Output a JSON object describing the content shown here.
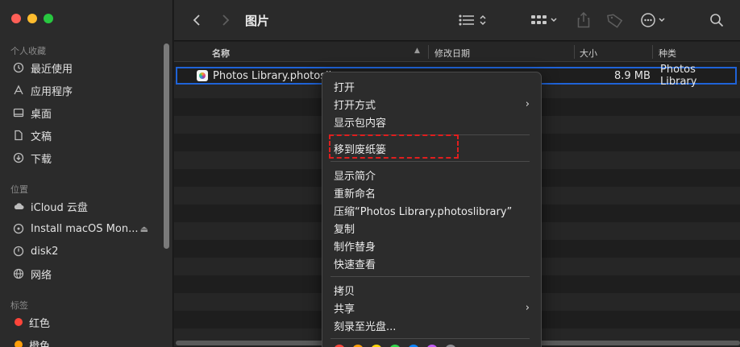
{
  "sidebar": {
    "favorites_title": "个人收藏",
    "favorites": [
      {
        "label": "最近使用",
        "icon": "clock-icon"
      },
      {
        "label": "应用程序",
        "icon": "apps-icon"
      },
      {
        "label": "桌面",
        "icon": "desktop-icon"
      },
      {
        "label": "文稿",
        "icon": "document-icon"
      },
      {
        "label": "下载",
        "icon": "download-icon"
      }
    ],
    "locations_title": "位置",
    "locations": [
      {
        "label": "iCloud 云盘",
        "icon": "cloud-icon"
      },
      {
        "label": "Install macOS Mon...",
        "icon": "disk-icon",
        "eject": true
      },
      {
        "label": "disk2",
        "icon": "disk-icon"
      },
      {
        "label": "网络",
        "icon": "globe-icon"
      }
    ],
    "tags_title": "标签",
    "tags": [
      {
        "label": "红色",
        "color": "#ff453a"
      },
      {
        "label": "橙色",
        "color": "#ff9f0a"
      }
    ]
  },
  "toolbar": {
    "title": "图片"
  },
  "columns": {
    "name": "名称",
    "modified": "修改日期",
    "size": "大小",
    "kind": "种类"
  },
  "file": {
    "name": "Photos Library.photosli",
    "size": "8.9 MB",
    "kind": "Photos Library"
  },
  "menu": {
    "open": "打开",
    "open_with": "打开方式",
    "show_package": "显示包内容",
    "move_to_trash": "移到废纸篓",
    "get_info": "显示简介",
    "rename": "重新命名",
    "compress": "压缩“Photos Library.photoslibrary”",
    "duplicate": "复制",
    "make_alias": "制作替身",
    "quick_look": "快速查看",
    "copy": "拷贝",
    "share": "共享",
    "burn": "刻录至光盘..."
  },
  "tag_colors": [
    "#ff453a",
    "#ff9f0a",
    "#ffd60a",
    "#32d74b",
    "#0a84ff",
    "#bf5af2",
    "#8e8e93"
  ]
}
